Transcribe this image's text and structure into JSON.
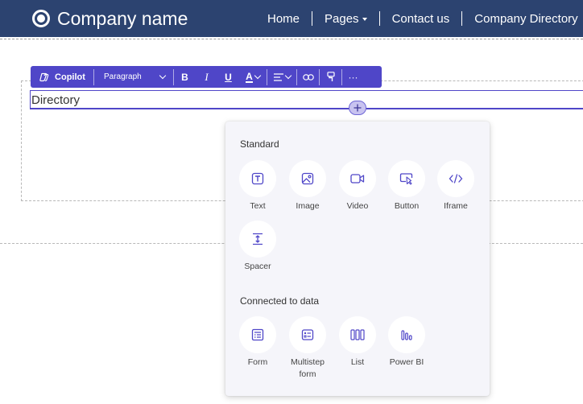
{
  "header": {
    "brand": "Company name",
    "nav": [
      "Home",
      "Pages",
      "Contact us",
      "Company Directory"
    ]
  },
  "toolbar": {
    "copilot": "Copilot",
    "paragraph": "Paragraph",
    "bold": "B",
    "italic": "I",
    "underline": "U",
    "font_color": "A",
    "more": "···"
  },
  "editor": {
    "text": "Directory"
  },
  "panel": {
    "standard_heading": "Standard",
    "standard_items": [
      "Text",
      "Image",
      "Video",
      "Button",
      "Iframe",
      "Spacer"
    ],
    "data_heading": "Connected to data",
    "data_items": [
      "Form",
      "Multistep form",
      "List",
      "Power BI"
    ]
  },
  "colors": {
    "header_bg": "#2c4370",
    "accent": "#4f46c8",
    "panel_bg": "#f5f5fa"
  }
}
